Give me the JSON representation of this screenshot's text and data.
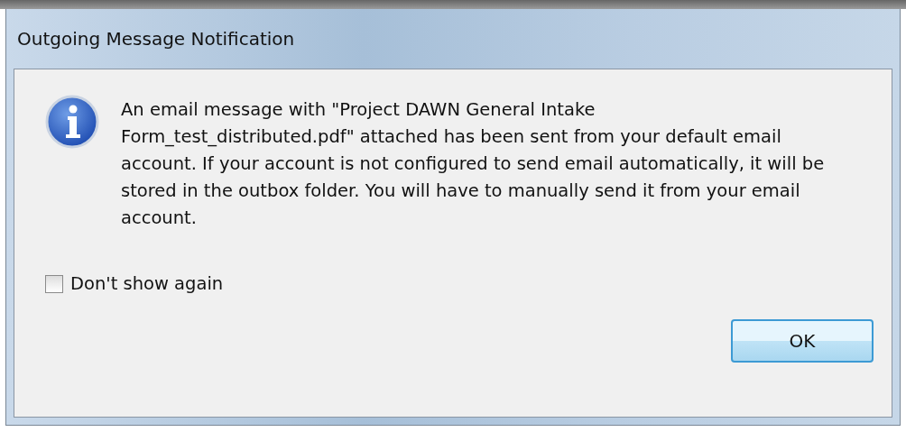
{
  "window": {
    "title": "Outgoing Message Notification"
  },
  "message": "An email message with \"Project DAWN General Intake Form_test_distributed.pdf\" attached has been sent from your default email account. If your account is not configured to send email automatically, it will be stored in the outbox folder. You will have to manually send it from your email account.",
  "checkbox": {
    "label": "Don't show again",
    "checked": false
  },
  "buttons": [
    {
      "label": "OK"
    }
  ]
}
